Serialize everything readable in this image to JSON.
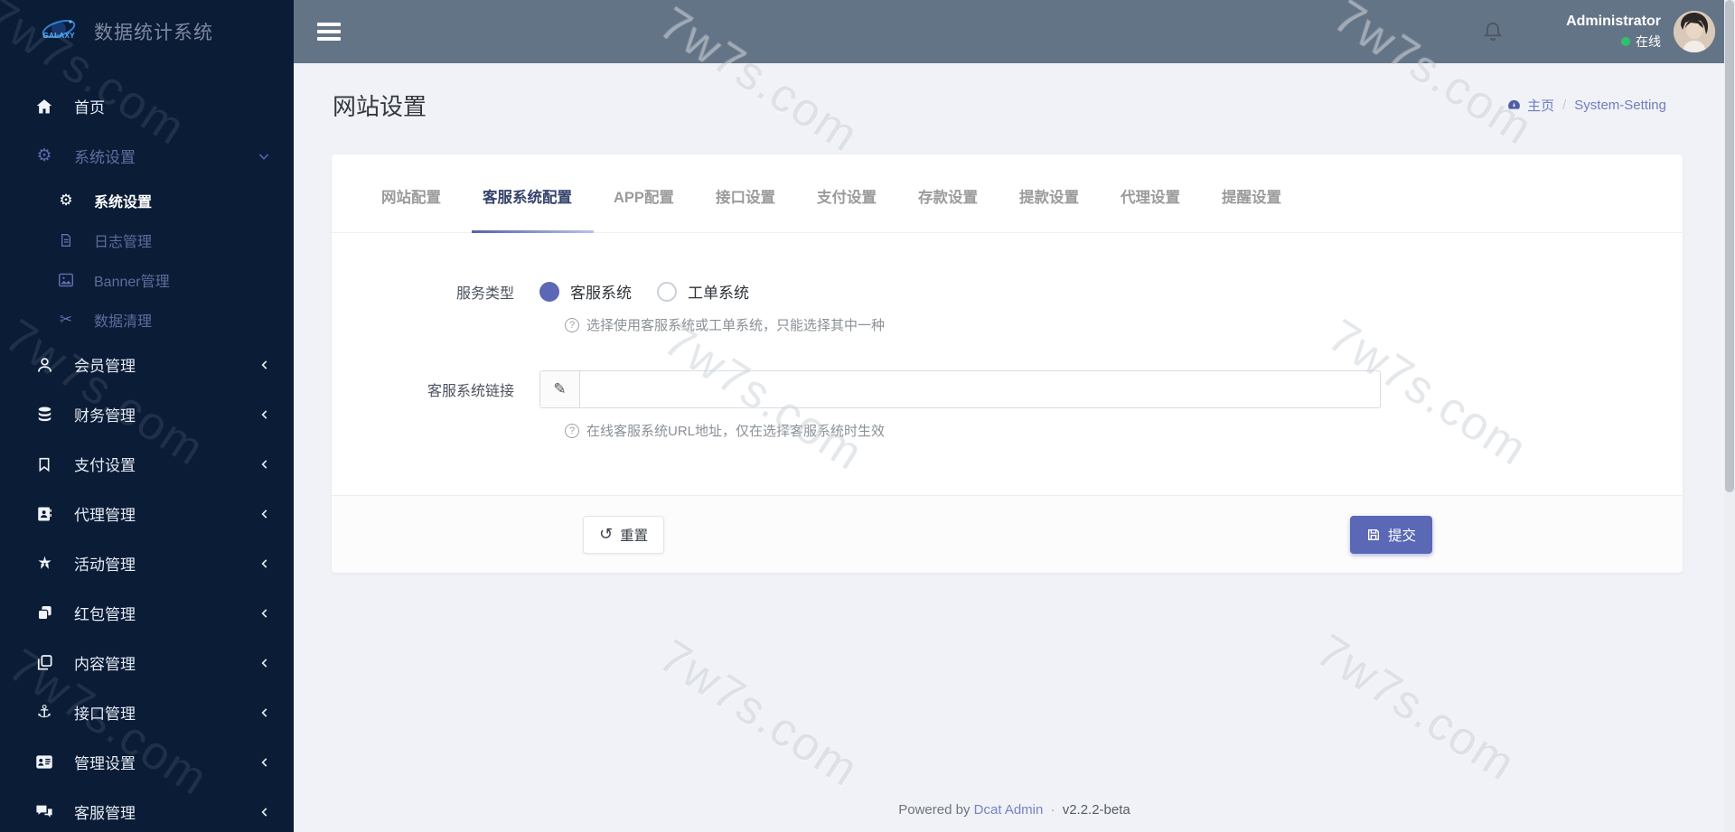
{
  "app": {
    "logo_text": "GALAXY",
    "title": "数据统计系统"
  },
  "watermark": {
    "text": "7w7s.com"
  },
  "sidebar": {
    "items": [
      {
        "label": "首页",
        "icon": "home-icon"
      },
      {
        "label": "系统设置",
        "icon": "cogs-icon",
        "state": "open"
      },
      {
        "label": "系统设置",
        "icon": "gear-icon",
        "child": true,
        "active": true
      },
      {
        "label": "日志管理",
        "icon": "file-icon",
        "child": true
      },
      {
        "label": "Banner管理",
        "icon": "image-icon",
        "child": true
      },
      {
        "label": "数据清理",
        "icon": "scissors-icon",
        "child": true
      },
      {
        "label": "会员管理",
        "icon": "user-icon"
      },
      {
        "label": "财务管理",
        "icon": "database-icon"
      },
      {
        "label": "支付设置",
        "icon": "bookmark-icon"
      },
      {
        "label": "代理管理",
        "icon": "address-book-icon"
      },
      {
        "label": "活动管理",
        "icon": "activity-icon"
      },
      {
        "label": "红包管理",
        "icon": "red-packet-icon"
      },
      {
        "label": "内容管理",
        "icon": "content-icon"
      },
      {
        "label": "接口管理",
        "icon": "anchor-icon"
      },
      {
        "label": "管理设置",
        "icon": "id-card-icon"
      },
      {
        "label": "客服管理",
        "icon": "comments-icon"
      }
    ]
  },
  "header": {
    "user": {
      "name": "Administrator",
      "status": "在线"
    }
  },
  "page": {
    "title": "网站设置",
    "breadcrumb": {
      "home": "主页",
      "current": "System-Setting"
    }
  },
  "tabs": {
    "active": "客服系统配置",
    "items": [
      {
        "label": "网站配置"
      },
      {
        "label": "客服系统配置"
      },
      {
        "label": "APP配置"
      },
      {
        "label": "接口设置"
      },
      {
        "label": "支付设置"
      },
      {
        "label": "存款设置"
      },
      {
        "label": "提款设置"
      },
      {
        "label": "代理设置"
      },
      {
        "label": "提醒设置"
      }
    ]
  },
  "form": {
    "service_type": {
      "label": "服务类型",
      "options": [
        "客服系统",
        "工单系统"
      ],
      "selected": "客服系统",
      "help": "选择使用客服系统或工单系统，只能选择其中一种"
    },
    "service_link": {
      "label": "客服系统链接",
      "value": "",
      "help": "在线客服系统URL地址，仅在选择客服系统时生效"
    }
  },
  "actions": {
    "reset": "重置",
    "submit": "提交"
  },
  "footer": {
    "powered_by": "Powered by",
    "brand": "Dcat Admin",
    "separator": "·",
    "version": "v2.2.2-beta"
  },
  "colors": {
    "sidebar_bg": "#0a1c36",
    "header_bg": "#647487",
    "primary": "#5a68b5",
    "online_green": "#2ec06f",
    "content_bg": "#f0f2f7"
  }
}
